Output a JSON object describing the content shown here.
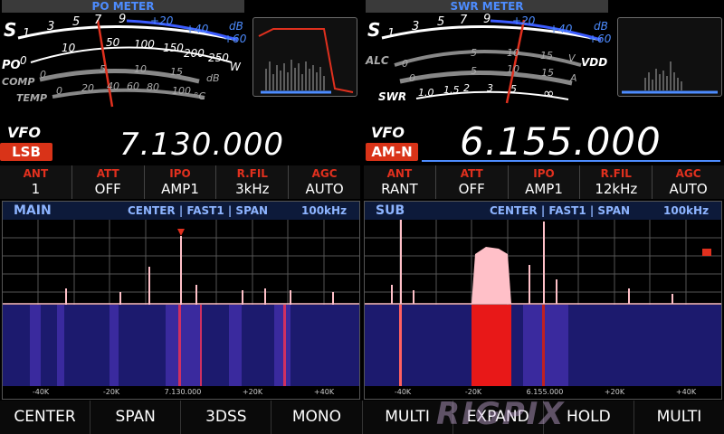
{
  "left_meter": {
    "title": "PO METER",
    "s_label": "S",
    "s_ticks": [
      "1",
      "3",
      "5",
      "7",
      "9",
      "+20",
      "+40",
      "+60"
    ],
    "s_unit": "dB",
    "po_label": "PO",
    "po_ticks": [
      "0",
      "10",
      "50",
      "100",
      "150",
      "200",
      "250"
    ],
    "po_unit": "W",
    "comp_label": "COMP",
    "comp_ticks": [
      "0",
      "5",
      "10",
      "15"
    ],
    "comp_unit": "dB",
    "temp_label": "TEMP",
    "temp_ticks": [
      "0",
      "20",
      "40",
      "60",
      "80",
      "100"
    ],
    "temp_unit": "°C"
  },
  "right_meter": {
    "title": "SWR METER",
    "s_label": "S",
    "s_ticks": [
      "1",
      "3",
      "5",
      "7",
      "9",
      "+20",
      "+40",
      "+60"
    ],
    "s_unit": "dB",
    "alc_label": "ALC",
    "vdd_ticks": [
      "0",
      "5",
      "10",
      "15"
    ],
    "vdd_unit": "V",
    "vdd_label": "VDD",
    "amp_ticks": [
      "0",
      "5",
      "10",
      "15"
    ],
    "amp_unit": "A",
    "swr_label": "SWR",
    "swr_ticks": [
      "1.0",
      "1.5",
      "2",
      "3",
      "5",
      "∞"
    ]
  },
  "main_vfo": {
    "label": "VFO",
    "mode": "LSB",
    "frequency": "7.130.000"
  },
  "sub_vfo": {
    "label": "VFO",
    "mode": "AM-N",
    "frequency": "6.155.000"
  },
  "main_params": [
    {
      "label": "ANT",
      "value": "1"
    },
    {
      "label": "ATT",
      "value": "OFF"
    },
    {
      "label": "IPO",
      "value": "AMP1"
    },
    {
      "label": "R.FIL",
      "value": "3kHz"
    },
    {
      "label": "AGC",
      "value": "AUTO"
    }
  ],
  "sub_params": [
    {
      "label": "ANT",
      "value": "RANT"
    },
    {
      "label": "ATT",
      "value": "OFF"
    },
    {
      "label": "IPO",
      "value": "AMP1"
    },
    {
      "label": "R.FIL",
      "value": "12kHz"
    },
    {
      "label": "AGC",
      "value": "AUTO"
    }
  ],
  "main_scope": {
    "name": "MAIN",
    "info": "CENTER | FAST1 | SPAN",
    "span": "100kHz",
    "ticks": [
      "-40K",
      "-20K",
      "7.130.000",
      "+20K",
      "+40K"
    ]
  },
  "sub_scope": {
    "name": "SUB",
    "info": "CENTER | FAST1 | SPAN",
    "span": "100kHz",
    "ticks": [
      "-40K",
      "-20K",
      "6.155.000",
      "+20K",
      "+40K"
    ]
  },
  "softkeys": [
    "CENTER",
    "SPAN",
    "3DSS",
    "MONO",
    "MULTI",
    "EXPAND",
    "HOLD",
    "MULTI"
  ],
  "watermark": "RIGPIX",
  "colors": {
    "accent_blue": "#4d8cff",
    "param_red": "#e0301e",
    "mode_badge": "#d93318",
    "spectrum_pink": "#ffc0c8",
    "waterfall_blue": "#1c1a6e"
  }
}
